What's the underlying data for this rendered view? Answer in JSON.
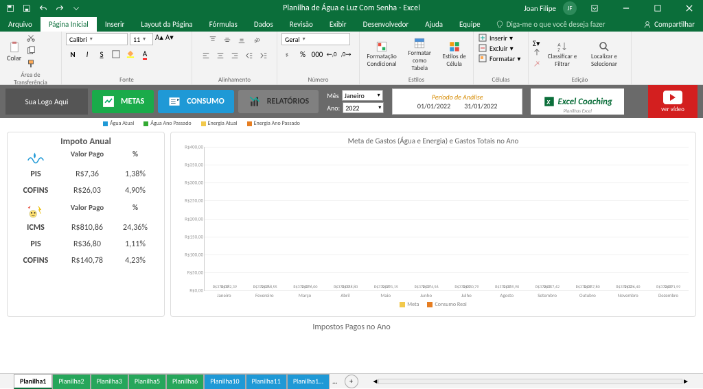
{
  "titlebar": {
    "title": "Planilha de Água e Luz Com Senha  -  Excel",
    "user": "Joan Filipe"
  },
  "menu": {
    "file": "Arquivo",
    "tabs": [
      "Página Inicial",
      "Inserir",
      "Layout da Página",
      "Fórmulas",
      "Dados",
      "Revisão",
      "Exibir",
      "Desenvolvedor",
      "Ajuda",
      "Equipe"
    ],
    "tell": "Diga-me o que você deseja fazer",
    "share": "Compartilhar"
  },
  "ribbon": {
    "clipboard": {
      "paste": "Colar",
      "label": "Área de Transferência"
    },
    "font": {
      "name": "Calibri",
      "size": "11",
      "label": "Fonte"
    },
    "alignment": {
      "label": "Alinhamento"
    },
    "number": {
      "format": "Geral",
      "label": "Número"
    },
    "styles": {
      "cond": "Formatação Condicional",
      "table": "Formatar como Tabela",
      "cell": "Estilos de Célula",
      "label": "Estilos"
    },
    "cells": {
      "insert": "Inserir",
      "delete": "Excluir",
      "format": "Formatar",
      "label": "Células"
    },
    "editing": {
      "sort": "Classificar e Filtrar",
      "find": "Localizar e Selecionar",
      "label": "Edição"
    }
  },
  "dash": {
    "logo": "Sua Logo Aqui",
    "nav": {
      "metas": "METAS",
      "consumo": "CONSUMO",
      "relatorios": "RELATÓRIOS"
    },
    "mes": {
      "label": "Mês",
      "value": "Janeiro"
    },
    "ano": {
      "label": "Ano:",
      "value": "2022"
    },
    "period": {
      "label": "Período de Análise",
      "from": "01/01/2022",
      "to": "31/01/2022"
    },
    "coach": "Excel Coaching",
    "coachsub": "Planilhas Excel",
    "video": "ver vídeo",
    "legend": [
      "Água Atual",
      "Água Ano Passado",
      "Energia Atual",
      "Energia Ano Passado"
    ]
  },
  "tax": {
    "title": "Impoto Anual",
    "h_valor": "Valor Pago",
    "h_pct": "%",
    "rows1": [
      {
        "n": "PIS",
        "v": "R$7,36",
        "p": "1,38%"
      },
      {
        "n": "COFINS",
        "v": "R$26,03",
        "p": "4,90%"
      }
    ],
    "rows2": [
      {
        "n": "ICMS",
        "v": "R$810,86",
        "p": "24,36%"
      },
      {
        "n": "PIS",
        "v": "R$36,80",
        "p": "1,11%"
      },
      {
        "n": "COFINS",
        "v": "R$140,78",
        "p": "4,23%"
      }
    ]
  },
  "chart_title": "Meta de Gastos (Água e Energia) e Gastos Totais no Ano",
  "chart_data": {
    "type": "bar",
    "categories": [
      "Janeiro",
      "Fevereiro",
      "Março",
      "Abril",
      "Maio",
      "Junho",
      "Julho",
      "Agosto",
      "Setembro",
      "Outubro",
      "Novembro",
      "Dezembro"
    ],
    "series": [
      {
        "name": "Meta",
        "values": [
          372.07,
          372.07,
          372.07,
          372.07,
          372.07,
          372.07,
          372.07,
          372.07,
          372.07,
          372.07,
          372.07,
          372.07
        ],
        "labels": [
          "R$372,07",
          "R$372,07",
          "R$372,07",
          "R$372,07",
          "R$372,07",
          "R$372,07",
          "R$372,07",
          "R$372,07",
          "R$372,07",
          "R$372,07",
          "R$372,07",
          "R$372,07"
        ]
      },
      {
        "name": "Consumo Real",
        "values": [
          282.39,
          268.55,
          376.0,
          348.8,
          291.15,
          374.56,
          330.79,
          309.9,
          357.42,
          357.8,
          326.4,
          371.59
        ],
        "labels": [
          "R$282,39",
          "R$268,55",
          "R$376,00",
          "R$348,80",
          "R$291,15",
          "R$374,56",
          "R$330,79",
          "R$309,90",
          "R$357,42",
          "R$357,80",
          "R$326,40",
          "R$371,59"
        ]
      }
    ],
    "ylim": [
      0,
      400
    ],
    "yticks": [
      "R$0,00",
      "R$50,00",
      "R$100,00",
      "R$150,00",
      "R$200,00",
      "R$250,00",
      "R$300,00",
      "R$350,00",
      "R$400,00"
    ],
    "legend": [
      "Meta",
      "Consumo Real"
    ]
  },
  "section2": "Impostos Pagos no Ano",
  "sheets": [
    "Planilha1",
    "Planilha2",
    "Planilha3",
    "Planilha5",
    "Planilha6",
    "Planilha10",
    "Planilha11",
    "Planilha1…"
  ],
  "more": "..."
}
